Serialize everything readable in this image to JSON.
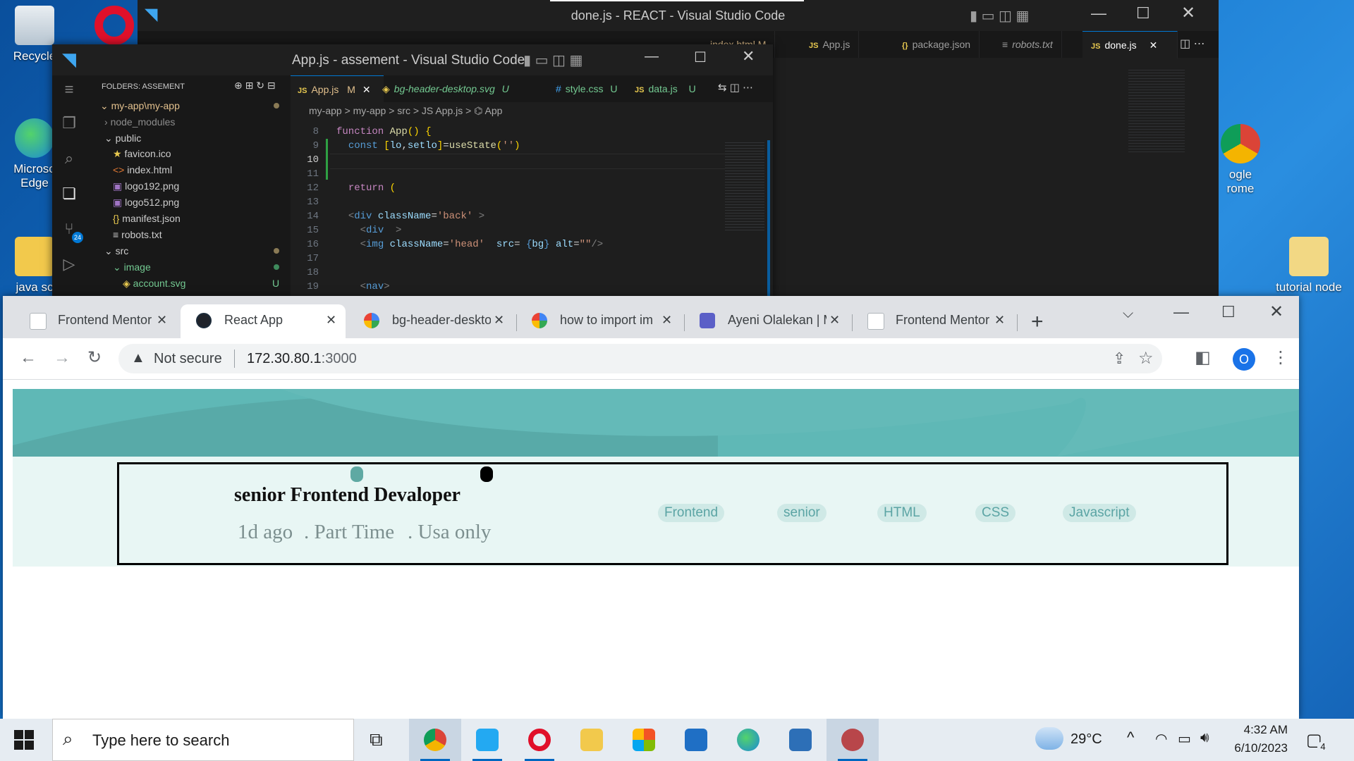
{
  "desktop": {
    "icons": {
      "recycle": "Recycle",
      "edge_line1": "Microso",
      "edge_line2": "Edge",
      "java": "java sc",
      "chrome_line1": "ogle",
      "chrome_line2": "rome",
      "tutorial": "tutorial node"
    }
  },
  "vscode_back": {
    "title": "done.js - REACT - Visual Studio Code",
    "tabs": [
      "App.js",
      "package.json",
      "robots.txt",
      "done.js"
    ],
    "partial_tabs_label": "index.html M",
    "active_tab": "done.js"
  },
  "vscode_front": {
    "title": "App.js - assement - Visual Studio Code",
    "explorer_header": "FOLDERS: ASSEMENT",
    "tree": {
      "root": "my-app\\my-app",
      "node_modules": "node_modules",
      "public": "public",
      "favicon": "favicon.ico",
      "index": "index.html",
      "logo192": "logo192.png",
      "logo512": "logo512.png",
      "manifest": "manifest.json",
      "robots": "robots.txt",
      "src": "src",
      "image": "image",
      "account": "account.svg",
      "account_badge": "U"
    },
    "source_control_badge": "24",
    "editor_tabs": {
      "t1": "App.js",
      "t1_badge": "M",
      "t2": "bg-header-desktop.svg",
      "t2_badge": "U",
      "t3": "style.css",
      "t3_badge": "U",
      "t4": "data.js",
      "t4_badge": "U"
    },
    "breadcrumb": "my-app > my-app > src > JS App.js > ⌬ App",
    "line_numbers": [
      "8",
      "9",
      "10",
      "11",
      "12",
      "13",
      "14",
      "15",
      "16",
      "17",
      "18",
      "19"
    ],
    "current_line": "10"
  },
  "chrome": {
    "tabs": [
      {
        "label": "Frontend Mentor"
      },
      {
        "label": "React App"
      },
      {
        "label": "bg-header-deskto"
      },
      {
        "label": "how to import im"
      },
      {
        "label": "Ayeni Olalekan | M"
      },
      {
        "label": "Frontend Mentor"
      }
    ],
    "security_label": "Not secure",
    "url_host": "172.30.80.1",
    "url_port": ":3000",
    "profile_initial": "O"
  },
  "page": {
    "job_title": "senior Frontend Devaloper",
    "posted": "1d ago",
    "contract": ". Part Time",
    "location": ". Usa only",
    "tags": [
      "Frontend",
      "senior",
      "HTML",
      "CSS",
      "Javascript"
    ]
  },
  "taskbar": {
    "search_placeholder": "Type here to search",
    "weather": "29°C",
    "time": "4:32 AM",
    "date": "6/10/2023",
    "notifications": "4"
  },
  "colors": {
    "hero_teal": "#5fb8b6",
    "card_bg": "#e8f6f4",
    "chip_bg": "#cfe9e6",
    "chip_text": "#5ba4a4"
  }
}
